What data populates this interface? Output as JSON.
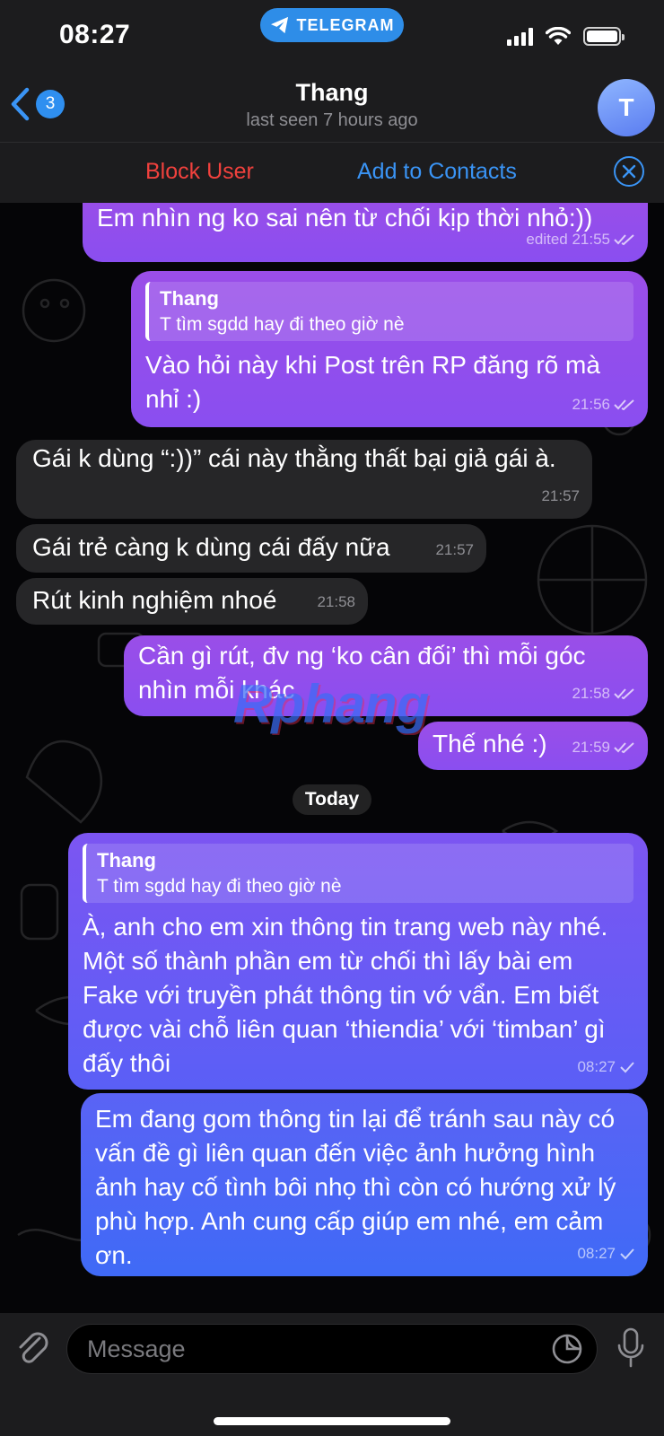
{
  "status_bar": {
    "time": "08:27",
    "pill_label": "TELEGRAM"
  },
  "header": {
    "unread_count": "3",
    "contact_name": "Thang",
    "last_seen": "last seen 7 hours ago",
    "avatar_letter": "T"
  },
  "action_bar": {
    "block_label": "Block User",
    "add_label": "Add to Contacts"
  },
  "messages": [
    {
      "dir": "out",
      "text": "Em nhìn ng ko sai nên từ chối kịp thời nhỏ:))",
      "time": "edited 21:55",
      "status": "read"
    },
    {
      "dir": "out",
      "reply_name": "Thang",
      "reply_text": "T tìm sgdd hay đi theo giờ nè",
      "text": "Vào hỏi này khi Post trên RP đăng rõ mà nhỉ :)",
      "time": "21:56",
      "status": "read"
    },
    {
      "dir": "in",
      "text": "Gái k dùng “:))” cái này thằng thất bại giả gái à.",
      "time": "21:57"
    },
    {
      "dir": "in",
      "text": "Gái trẻ càng k dùng cái đấy nữa",
      "time": "21:57"
    },
    {
      "dir": "in",
      "text": "Rút kinh nghiệm nhoé",
      "time": "21:58"
    },
    {
      "dir": "out",
      "text": "Cần gì rút, đv ng ‘ko cân đối’ thì mỗi góc nhìn mỗi khác",
      "time": "21:58",
      "status": "read"
    },
    {
      "dir": "out",
      "text": "Thế nhé :)",
      "time": "21:59",
      "status": "read"
    },
    {
      "dir": "out",
      "reply_name": "Thang",
      "reply_text": "T tìm sgdd hay đi theo giờ nè",
      "text": "À, anh cho em xin thông tin trang web này nhé. Một số thành phần em từ chối thì lấy bài em Fake với truyền phát thông tin vớ vẩn. Em biết được vài chỗ liên quan ‘thiendia’ với ‘timban’ gì đấy thôi",
      "time": "08:27",
      "status": "sent"
    },
    {
      "dir": "out",
      "text": "Em đang gom thông tin lại để tránh sau này có vấn đề gì liên quan đến việc ảnh hưởng hình ảnh hay cố tình bôi nhọ thì còn có hướng xử lý phù hợp. Anh cung cấp giúp em nhé, em cảm ơn.",
      "time": "08:27",
      "status": "sent"
    }
  ],
  "date_separator": "Today",
  "watermark": "Rphang",
  "composer": {
    "placeholder": "Message"
  },
  "colors": {
    "accent": "#3a94f5",
    "danger": "#f0413d",
    "outgoing": "#8a4ef0",
    "incoming": "#262628"
  },
  "icons": [
    "back-chevron-icon",
    "telegram-plane-icon",
    "signal-icon",
    "wifi-icon",
    "battery-icon",
    "close-circle-icon",
    "double-check-icon",
    "single-check-icon",
    "paperclip-icon",
    "sticker-icon",
    "microphone-icon"
  ]
}
